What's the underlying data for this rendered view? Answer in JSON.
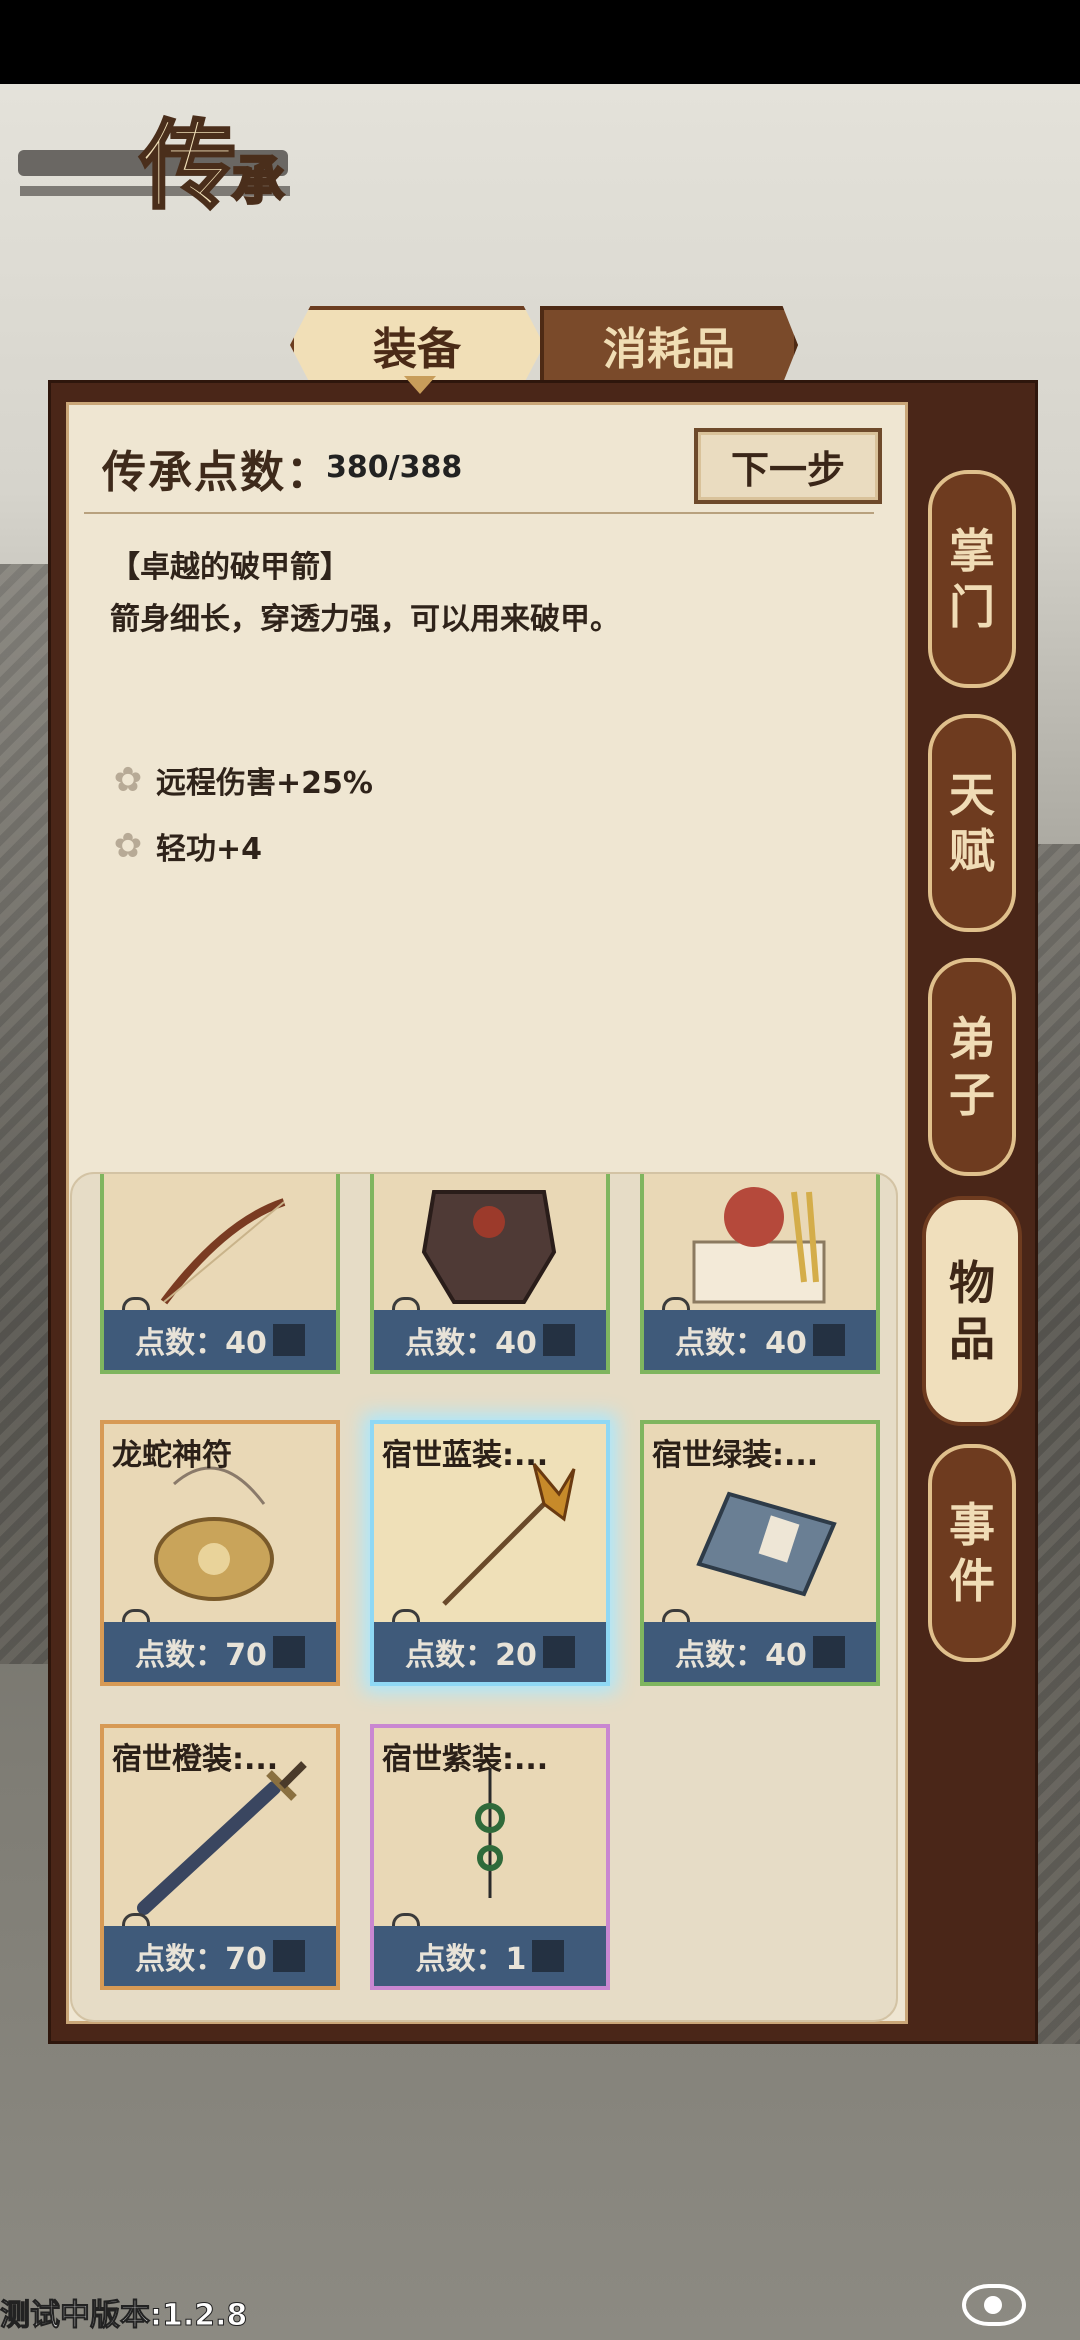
{
  "title": {
    "main": "传",
    "small": "承"
  },
  "tabs": {
    "equipment": "装备",
    "consumables": "消耗品"
  },
  "header": {
    "points_label": "传承点数：",
    "points_value": "380/388",
    "next_button": "下一步"
  },
  "item": {
    "name": "【卓越的破甲箭】",
    "description": "箭身细长，穿透力强，可以用来破甲。",
    "stats": [
      "远程伤害+25%",
      "轻功+4"
    ]
  },
  "cards": [
    {
      "name": "",
      "cost": "点数：40",
      "icon": "bow-icon",
      "border": "green"
    },
    {
      "name": "",
      "cost": "点数：40",
      "icon": "armor-icon",
      "border": "green"
    },
    {
      "name": "",
      "cost": "点数：40",
      "icon": "seal-icon",
      "border": "green"
    },
    {
      "name": "龙蛇神符",
      "cost": "点数：70",
      "icon": "amulet-icon",
      "border": "orange"
    },
    {
      "name": "宿世蓝装:...",
      "cost": "点数：20",
      "icon": "spear-icon",
      "border": "blue"
    },
    {
      "name": "宿世绿装:...",
      "cost": "点数：40",
      "icon": "book-icon",
      "border": "green"
    },
    {
      "name": "宿世橙装:...",
      "cost": "点数：70",
      "icon": "sword-icon",
      "border": "orange"
    },
    {
      "name": "宿世紫装:...",
      "cost": "点数：1",
      "icon": "pendant-icon",
      "border": "purple"
    }
  ],
  "side_tabs": [
    "掌门",
    "天赋",
    "弟子",
    "物品",
    "事件"
  ],
  "active_side_tab": "物品",
  "version": "测试中版本:1.2.8",
  "colors": {
    "panel_frame": "#4a2618",
    "cost_bar": "#3f5a7a",
    "tab_active": "#f1dfb7"
  }
}
